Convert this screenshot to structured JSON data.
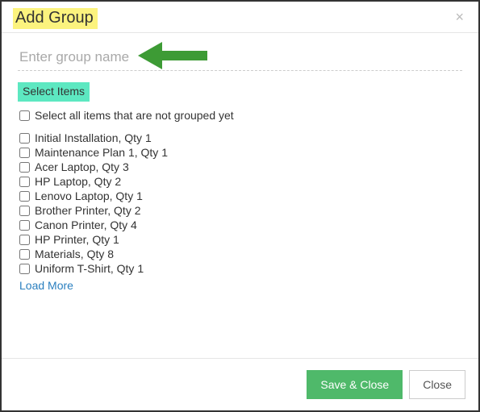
{
  "header": {
    "title": "Add Group",
    "close": "×"
  },
  "input": {
    "placeholder": "Enter group name"
  },
  "section": {
    "label": "Select Items",
    "select_all": "Select all items that are not grouped yet"
  },
  "items": [
    "Initial Installation, Qty 1",
    "Maintenance Plan 1, Qty 1",
    "Acer Laptop, Qty 3",
    "HP Laptop, Qty 2",
    "Lenovo Laptop, Qty 1",
    "Brother Printer, Qty 2",
    "Canon Printer, Qty 4",
    "HP Printer, Qty 1",
    "Materials, Qty 8",
    "Uniform T-Shirt, Qty 1"
  ],
  "load_more": "Load More",
  "footer": {
    "save": "Save & Close",
    "close": "Close"
  }
}
